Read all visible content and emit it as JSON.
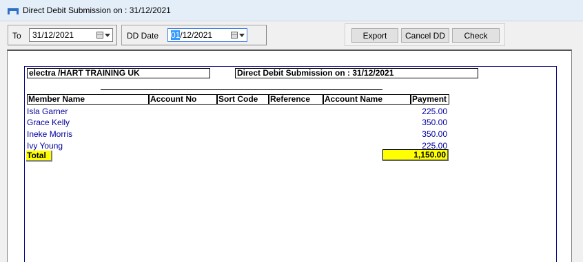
{
  "window": {
    "title": "Direct Debit Submission on : 31/12/2021"
  },
  "filters": {
    "to_label": "To",
    "to_value": "31/12/2021",
    "dd_date_label": "DD Date",
    "dd_date_selected": "01",
    "dd_date_rest": "/12/2021"
  },
  "actions": {
    "export_label": "Export",
    "cancel_dd_label": "Cancel DD",
    "check_label": "Check"
  },
  "report": {
    "company": "electra /HART TRAINING UK",
    "title": "Direct Debit Submission on : 31/12/2021",
    "columns": {
      "member_name": "Member Name",
      "account_no": "Account No",
      "sort_code": "Sort Code",
      "reference": "Reference",
      "account_name": "Account Name",
      "payment": "Payment"
    },
    "rows": [
      {
        "member_name": "Isla Garner",
        "payment": "225.00"
      },
      {
        "member_name": "Grace Kelly",
        "payment": "350.00"
      },
      {
        "member_name": "Ineke Morris",
        "payment": "350.00"
      },
      {
        "member_name": "Ivy Young",
        "payment": "225.00"
      }
    ],
    "total_label": "Total",
    "total_value": "1,150.00"
  },
  "colors": {
    "titlebar_bg": "#e4eef8",
    "row_text": "#0000a0",
    "total_highlight": "#ffff00",
    "selection": "#3399ff"
  },
  "icons": {
    "app": "app-table-icon",
    "calendar": "calendar-dropdown-icon"
  }
}
